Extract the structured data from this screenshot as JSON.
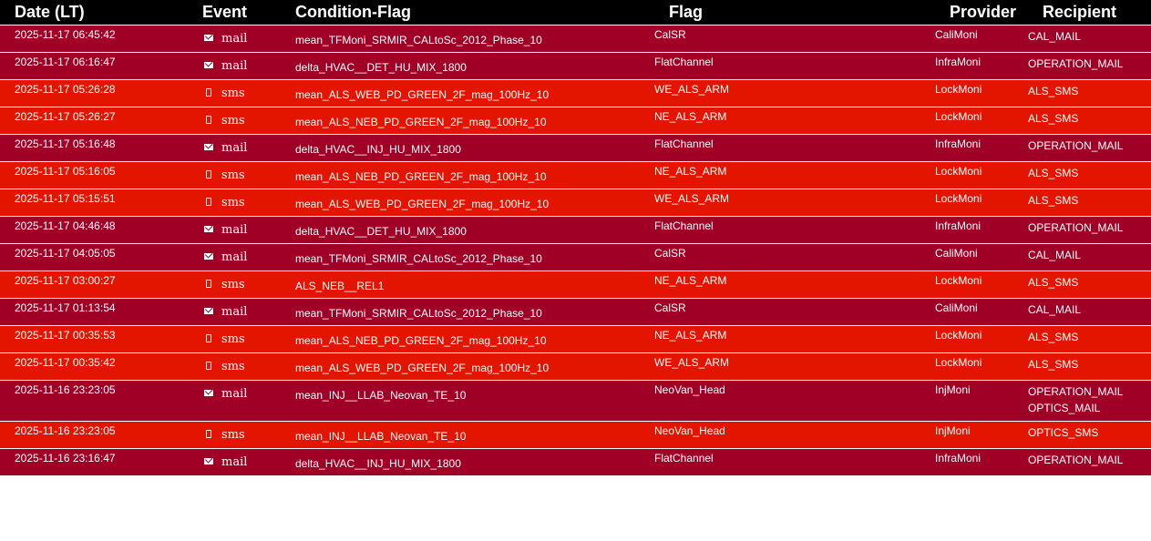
{
  "headers": {
    "date": "Date (LT)",
    "event": "Event",
    "condition": "Condition-Flag",
    "flag": "Flag",
    "provider": "Provider",
    "recipient": "Recipient"
  },
  "colors": {
    "header_bg": "#000000",
    "mail_row": "#a00025",
    "sms_row": "#e31400",
    "text": "#ffffff"
  },
  "rows": [
    {
      "date": "2025-11-17 06:45:42",
      "event": "mail",
      "icon": "envelope-icon",
      "condition": "mean_TFMoni_SRMIR_CALtoSc_2012_Phase_10",
      "flag": "CalSR",
      "provider": "CaliMoni",
      "recipients": [
        "CAL_MAIL"
      ]
    },
    {
      "date": "2025-11-17 06:16:47",
      "event": "mail",
      "icon": "envelope-icon",
      "condition": "delta_HVAC__DET_HU_MIX_1800",
      "flag": "FlatChannel",
      "provider": "InfraMoni",
      "recipients": [
        "OPERATION_MAIL"
      ]
    },
    {
      "date": "2025-11-17 05:26:28",
      "event": "sms",
      "icon": "mobile-phone-icon",
      "condition": "mean_ALS_WEB_PD_GREEN_2F_mag_100Hz_10",
      "flag": "WE_ALS_ARM",
      "provider": "LockMoni",
      "recipients": [
        "ALS_SMS"
      ]
    },
    {
      "date": "2025-11-17 05:26:27",
      "event": "sms",
      "icon": "mobile-phone-icon",
      "condition": "mean_ALS_NEB_PD_GREEN_2F_mag_100Hz_10",
      "flag": "NE_ALS_ARM",
      "provider": "LockMoni",
      "recipients": [
        "ALS_SMS"
      ]
    },
    {
      "date": "2025-11-17 05:16:48",
      "event": "mail",
      "icon": "envelope-icon",
      "condition": "delta_HVAC__INJ_HU_MIX_1800",
      "flag": "FlatChannel",
      "provider": "InfraMoni",
      "recipients": [
        "OPERATION_MAIL"
      ]
    },
    {
      "date": "2025-11-17 05:16:05",
      "event": "sms",
      "icon": "mobile-phone-icon",
      "condition": "mean_ALS_NEB_PD_GREEN_2F_mag_100Hz_10",
      "flag": "NE_ALS_ARM",
      "provider": "LockMoni",
      "recipients": [
        "ALS_SMS"
      ]
    },
    {
      "date": "2025-11-17 05:15:51",
      "event": "sms",
      "icon": "mobile-phone-icon",
      "condition": "mean_ALS_WEB_PD_GREEN_2F_mag_100Hz_10",
      "flag": "WE_ALS_ARM",
      "provider": "LockMoni",
      "recipients": [
        "ALS_SMS"
      ]
    },
    {
      "date": "2025-11-17 04:46:48",
      "event": "mail",
      "icon": "envelope-icon",
      "condition": "delta_HVAC__DET_HU_MIX_1800",
      "flag": "FlatChannel",
      "provider": "InfraMoni",
      "recipients": [
        "OPERATION_MAIL"
      ]
    },
    {
      "date": "2025-11-17 04:05:05",
      "event": "mail",
      "icon": "envelope-icon",
      "condition": "mean_TFMoni_SRMIR_CALtoSc_2012_Phase_10",
      "flag": "CalSR",
      "provider": "CaliMoni",
      "recipients": [
        "CAL_MAIL"
      ]
    },
    {
      "date": "2025-11-17 03:00:27",
      "event": "sms",
      "icon": "mobile-phone-icon",
      "condition": "ALS_NEB__REL1",
      "flag": "NE_ALS_ARM",
      "provider": "LockMoni",
      "recipients": [
        "ALS_SMS"
      ]
    },
    {
      "date": "2025-11-17 01:13:54",
      "event": "mail",
      "icon": "envelope-icon",
      "condition": "mean_TFMoni_SRMIR_CALtoSc_2012_Phase_10",
      "flag": "CalSR",
      "provider": "CaliMoni",
      "recipients": [
        "CAL_MAIL"
      ]
    },
    {
      "date": "2025-11-17 00:35:53",
      "event": "sms",
      "icon": "mobile-phone-icon",
      "condition": "mean_ALS_NEB_PD_GREEN_2F_mag_100Hz_10",
      "flag": "NE_ALS_ARM",
      "provider": "LockMoni",
      "recipients": [
        "ALS_SMS"
      ]
    },
    {
      "date": "2025-11-17 00:35:42",
      "event": "sms",
      "icon": "mobile-phone-icon",
      "condition": "mean_ALS_WEB_PD_GREEN_2F_mag_100Hz_10",
      "flag": "WE_ALS_ARM",
      "provider": "LockMoni",
      "recipients": [
        "ALS_SMS"
      ]
    },
    {
      "date": "2025-11-16 23:23:05",
      "event": "mail",
      "icon": "envelope-icon",
      "condition": "mean_INJ__LLAB_Neovan_TE_10",
      "flag": "NeoVan_Head",
      "provider": "InjMoni",
      "recipients": [
        "OPERATION_MAIL",
        "OPTICS_MAIL"
      ]
    },
    {
      "date": "2025-11-16 23:23:05",
      "event": "sms",
      "icon": "mobile-phone-icon",
      "condition": "mean_INJ__LLAB_Neovan_TE_10",
      "flag": "NeoVan_Head",
      "provider": "InjMoni",
      "recipients": [
        "OPTICS_SMS"
      ]
    },
    {
      "date": "2025-11-16 23:16:47",
      "event": "mail",
      "icon": "envelope-icon",
      "condition": "delta_HVAC__INJ_HU_MIX_1800",
      "flag": "FlatChannel",
      "provider": "InfraMoni",
      "recipients": [
        "OPERATION_MAIL"
      ]
    }
  ]
}
